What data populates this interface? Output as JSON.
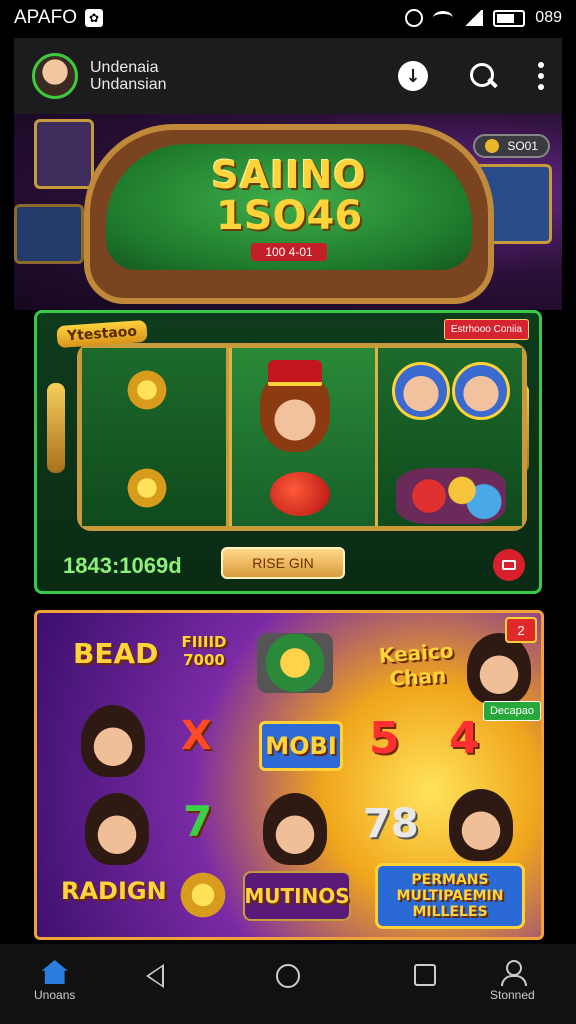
{
  "status_bar": {
    "carrier": "APAFO",
    "time": "089"
  },
  "app_bar": {
    "title_line1": "Undenaia",
    "title_line2": "Undansian"
  },
  "hero": {
    "title": "SAIINO",
    "number": "1SO46",
    "tag": "100 4-01",
    "pill_text": "SO01"
  },
  "slot": {
    "label": "Ytestaoo",
    "badge": "Estrhooo Coniia",
    "balance": "1843:1069d",
    "spin_label": "RISE GIN"
  },
  "games": {
    "corner_badge": "2",
    "side_tag": "Decapao",
    "tiles": [
      "BEAD",
      "FIIIID 7000",
      "Keaico Chan",
      "X",
      "MOBI",
      "5",
      "4",
      "7",
      "78",
      "RADIGN",
      "MUTINOS",
      "PERMANS MULTIPAEMIN MILLELES"
    ]
  },
  "nav": {
    "home_label": "Unoans",
    "profile_label": "Stonned"
  },
  "colors": {
    "accent_green": "#37c94a",
    "gold": "#ffd43b",
    "brand_blue": "#2b7de0",
    "alert_red": "#d8202c"
  }
}
